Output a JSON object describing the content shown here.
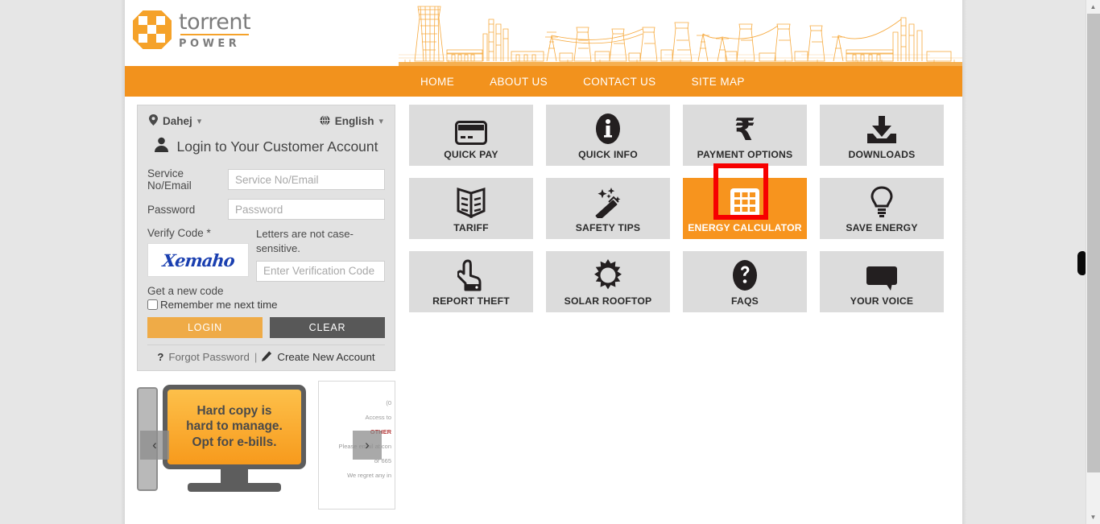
{
  "brand": {
    "name": "torrent",
    "tagline": "POWER",
    "accent": "#f5a22a",
    "nav_bg": "#f2921d"
  },
  "nav": {
    "items": [
      {
        "label": "HOME"
      },
      {
        "label": "ABOUT US"
      },
      {
        "label": "CONTACT US"
      },
      {
        "label": "SITE MAP"
      }
    ]
  },
  "login": {
    "city": "Dahej",
    "language": "English",
    "heading": "Login to Your Customer Account",
    "service_label": "Service No/Email",
    "service_placeholder": "Service No/Email",
    "service_value": "",
    "password_label": "Password",
    "password_placeholder": "Password",
    "password_value": "",
    "verify_label": "Verify Code *",
    "captcha_text": "Xemaho",
    "captcha_note": "Letters are not case-sensitive.",
    "verify_placeholder": "Enter Verification Code",
    "verify_value": "",
    "new_code": "Get a new code",
    "remember": "Remember me next time",
    "remember_checked": false,
    "login_button": "LOGIN",
    "clear_button": "CLEAR",
    "forgot": "Forgot Password",
    "separator": "|",
    "create_account": "Create New Account",
    "login_color": "#efab47",
    "clear_color": "#585858"
  },
  "carousel": {
    "prev": "‹",
    "next": "›",
    "slide1_line1": "Hard copy is",
    "slide1_line2": "hard to manage.",
    "slide1_line3": "Opt for e-bills.",
    "slide2_line1": "(0",
    "slide2_line2": "Access to",
    "slide2_line3": "OTHER",
    "slide2_line4": "Please email at con",
    "slide2_line5": "or 665",
    "slide2_line6": "We regret any in"
  },
  "tiles": [
    {
      "label": "QUICK PAY",
      "icon": "credit-card-icon",
      "active": false
    },
    {
      "label": "QUICK INFO",
      "icon": "info-icon",
      "active": false
    },
    {
      "label": "PAYMENT OPTIONS",
      "icon": "rupee-icon",
      "active": false
    },
    {
      "label": "DOWNLOADS",
      "icon": "download-icon",
      "active": false
    },
    {
      "label": "TARIFF",
      "icon": "book-icon",
      "active": false
    },
    {
      "label": "SAFETY TIPS",
      "icon": "magic-wand-icon",
      "active": false
    },
    {
      "label": "ENERGY CALCULATOR",
      "icon": "calculator-grid-icon",
      "active": true
    },
    {
      "label": "SAVE ENERGY",
      "icon": "bulb-icon",
      "active": false
    },
    {
      "label": "REPORT THEFT",
      "icon": "pointing-hand-icon",
      "active": false
    },
    {
      "label": "SOLAR ROOFTOP",
      "icon": "sun-icon",
      "active": false
    },
    {
      "label": "FAQS",
      "icon": "question-mark-icon",
      "active": false
    },
    {
      "label": "YOUR VOICE",
      "icon": "speech-bubble-icon",
      "active": false
    }
  ],
  "highlight": {
    "color": "#f70000",
    "target": "ENERGY CALCULATOR"
  }
}
